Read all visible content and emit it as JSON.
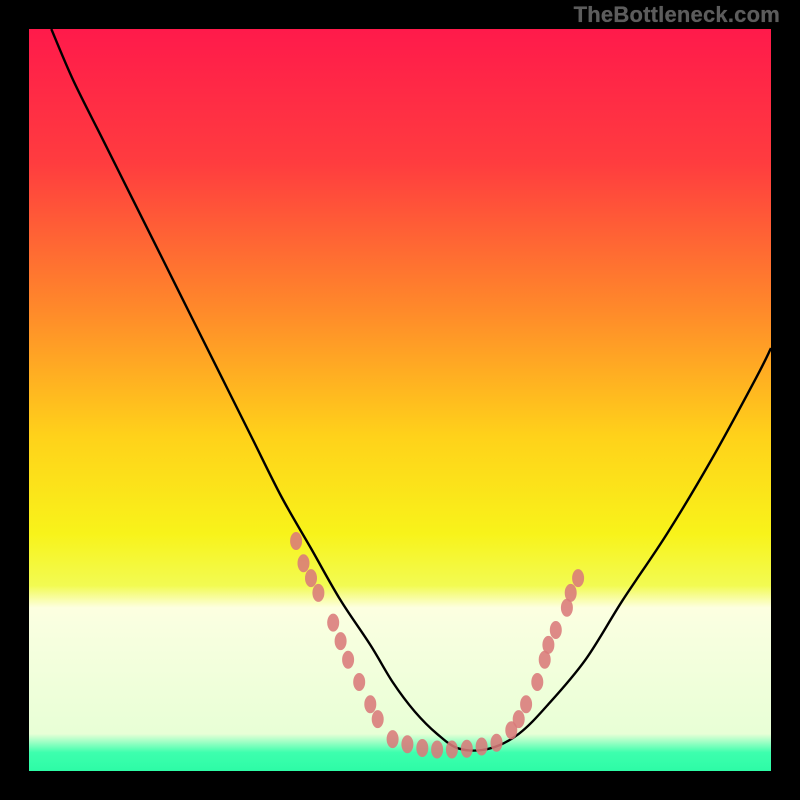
{
  "watermark": "TheBottleneck.com",
  "chart_data": {
    "type": "line",
    "title": "",
    "xlabel": "",
    "ylabel": "",
    "xlim": [
      0,
      100
    ],
    "ylim": [
      0,
      100
    ],
    "gradient_stops": [
      {
        "offset": 0,
        "color": "#ff1a4b"
      },
      {
        "offset": 18,
        "color": "#ff3c3f"
      },
      {
        "offset": 38,
        "color": "#ff8a2a"
      },
      {
        "offset": 55,
        "color": "#ffd21a"
      },
      {
        "offset": 68,
        "color": "#f8f31a"
      },
      {
        "offset": 75,
        "color": "#f2fb52"
      },
      {
        "offset": 78,
        "color": "#fdffe0"
      },
      {
        "offset": 80,
        "color": "#f9ffe0"
      },
      {
        "offset": 95,
        "color": "#e8ffd6"
      },
      {
        "offset": 97.5,
        "color": "#3dffae"
      },
      {
        "offset": 100,
        "color": "#2dfca6"
      }
    ],
    "series": [
      {
        "name": "bottleneck-curve",
        "color": "#000000",
        "x": [
          3,
          6,
          10,
          14,
          18,
          22,
          26,
          30,
          34,
          38,
          42,
          46,
          49,
          52,
          55,
          58,
          62,
          66,
          70,
          75,
          80,
          86,
          92,
          98,
          100
        ],
        "y": [
          100,
          93,
          85,
          77,
          69,
          61,
          53,
          45,
          37,
          30,
          23,
          17,
          12,
          8,
          5,
          3,
          3,
          5,
          9,
          15,
          23,
          32,
          42,
          53,
          57
        ]
      }
    ],
    "marker_clusters": [
      {
        "name": "left-band-markers",
        "color": "#d97a7a",
        "points": [
          {
            "x": 36,
            "y": 31
          },
          {
            "x": 37,
            "y": 28
          },
          {
            "x": 38,
            "y": 26
          },
          {
            "x": 39,
            "y": 24
          },
          {
            "x": 41,
            "y": 20
          },
          {
            "x": 42,
            "y": 17.5
          },
          {
            "x": 43,
            "y": 15
          },
          {
            "x": 44.5,
            "y": 12
          },
          {
            "x": 46,
            "y": 9
          },
          {
            "x": 47,
            "y": 7
          }
        ]
      },
      {
        "name": "valley-floor-markers",
        "color": "#d97a7a",
        "points": [
          {
            "x": 49,
            "y": 4.3
          },
          {
            "x": 51,
            "y": 3.6
          },
          {
            "x": 53,
            "y": 3.1
          },
          {
            "x": 55,
            "y": 2.9
          },
          {
            "x": 57,
            "y": 2.9
          },
          {
            "x": 59,
            "y": 3.0
          },
          {
            "x": 61,
            "y": 3.3
          },
          {
            "x": 63,
            "y": 3.8
          }
        ]
      },
      {
        "name": "right-band-markers",
        "color": "#d97a7a",
        "points": [
          {
            "x": 65,
            "y": 5.5
          },
          {
            "x": 66,
            "y": 7
          },
          {
            "x": 67,
            "y": 9
          },
          {
            "x": 68.5,
            "y": 12
          },
          {
            "x": 69.5,
            "y": 15
          },
          {
            "x": 70,
            "y": 17
          },
          {
            "x": 71,
            "y": 19
          },
          {
            "x": 72.5,
            "y": 22
          },
          {
            "x": 73,
            "y": 24
          },
          {
            "x": 74,
            "y": 26
          }
        ]
      }
    ]
  }
}
